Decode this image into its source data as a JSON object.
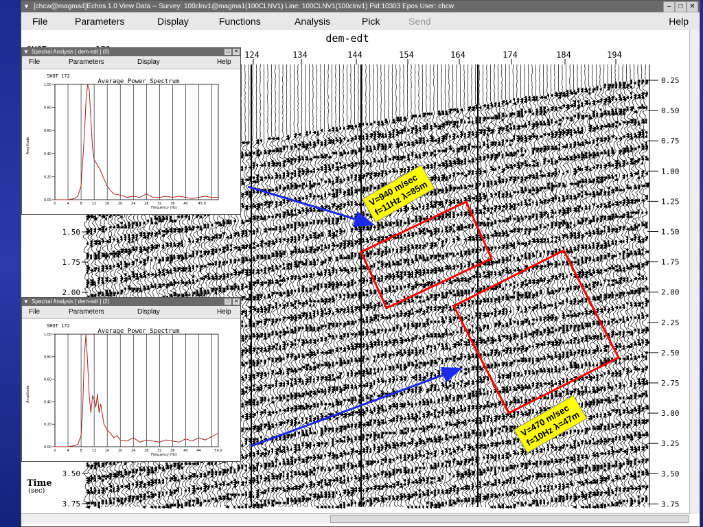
{
  "window": {
    "title": "[chcw@magma4]Echos 1.0 View Data   -- Survey: 100clnv1@magma1(100CLNV1)   Line: 100CLNV1(100clnv1)   Pid:10303   Epos User: chcw",
    "menu": [
      "File",
      "Parameters",
      "Display",
      "Functions",
      "Analysis",
      "Pick",
      "Send",
      "Help"
    ],
    "disabled_menu": "Send"
  },
  "plot": {
    "title": "dem-edt",
    "shot_label": "SHOT",
    "shot_value": "172",
    "trace_ticks": [
      "124",
      "134",
      "144",
      "154",
      "164",
      "174",
      "184",
      "194"
    ],
    "time_ticks_right": [
      "0.25",
      "0.50",
      "0.75",
      "1.00",
      "1.25",
      "1.50",
      "1.75",
      "2.00",
      "2.25",
      "2.50",
      "2.75",
      "3.00",
      "3.25",
      "3.50",
      "3.75"
    ],
    "time_ticks_left": [
      "1.50",
      "1.75",
      "2.00",
      "3.50",
      "3.75"
    ],
    "time_axis_label": "Time",
    "time_axis_unit": "(sec)"
  },
  "spectral_windows": [
    {
      "title": "Spectral Analysis [ dem-edt ] (0)",
      "menu": [
        "File",
        "Parameters",
        "Display",
        "Help"
      ],
      "header": "SHOT 172",
      "chart_title": "Average Power Spectrum",
      "xlabel": "Frequency (Hz)",
      "ylabel": "Amplitude"
    },
    {
      "title": "Spectral Analysis [ dem-edt ] (2)",
      "menu": [
        "File",
        "Parameters",
        "Display",
        "Help"
      ],
      "header": "SHOT 172",
      "chart_title": "Average Power Spectrum",
      "xlabel": "Frequency (Hz)",
      "ylabel": "Amplitude"
    }
  ],
  "chart_data": [
    {
      "type": "line",
      "title": "Average Power Spectrum",
      "xlabel": "Frequency (Hz)",
      "ylabel": "Amplitude",
      "xlim": [
        0,
        50
      ],
      "ylim": [
        0,
        1
      ],
      "x_ticks": [
        "0",
        "4",
        "8",
        "12",
        "16",
        "20",
        "24",
        "28",
        "32",
        "36",
        "40",
        "44",
        "48"
      ],
      "x_ticks_labeled": [
        "0",
        "4",
        "8",
        "12",
        "16",
        "20",
        "24",
        "28",
        "32",
        "36",
        "40",
        "45.0"
      ],
      "y_ticks": [
        "0.00",
        "0.20",
        "0.40",
        "0.60",
        "0.80",
        "1.00"
      ],
      "grid": true,
      "x": [
        0,
        4,
        6,
        7,
        8,
        9,
        9.5,
        10,
        10.5,
        11,
        11.5,
        12,
        13,
        14,
        15,
        16,
        17,
        18,
        20,
        22,
        24,
        26,
        28,
        30,
        32,
        34,
        36,
        38,
        40,
        42,
        44,
        46,
        48,
        50
      ],
      "y": [
        0,
        0,
        0.01,
        0.03,
        0.12,
        0.55,
        0.85,
        1.0,
        0.95,
        0.7,
        0.45,
        0.35,
        0.3,
        0.25,
        0.18,
        0.12,
        0.08,
        0.05,
        0.04,
        0.02,
        0.03,
        0.02,
        0.05,
        0.02,
        0.02,
        0.03,
        0.02,
        0.03,
        0.02,
        0.01,
        0.02,
        0.03,
        0.02,
        0.02
      ],
      "color": "#b02020"
    },
    {
      "type": "line",
      "title": "Average Power Spectrum",
      "xlabel": "Frequency (Hz)",
      "ylabel": "Amplitude",
      "xlim": [
        0,
        50
      ],
      "ylim": [
        0,
        1
      ],
      "x_ticks": [
        "0",
        "4",
        "8",
        "12",
        "16",
        "20",
        "24",
        "28",
        "32",
        "36",
        "40",
        "44",
        "48"
      ],
      "x_ticks_labeled": [
        "0",
        "4",
        "8",
        "12",
        "16",
        "20",
        "24",
        "28",
        "32",
        "36",
        "40",
        "44",
        "50.0"
      ],
      "y_ticks": [
        "0.00",
        "0.20",
        "0.40",
        "0.60",
        "0.80",
        "1.00"
      ],
      "grid": true,
      "x": [
        0,
        4,
        6,
        7,
        8,
        8.5,
        9,
        9.5,
        10,
        10.5,
        11,
        11.5,
        12,
        12.5,
        13,
        13.5,
        14,
        15,
        16,
        17,
        18,
        19,
        20,
        22,
        24,
        26,
        28,
        30,
        32,
        34,
        36,
        38,
        40,
        42,
        44,
        46,
        48,
        50
      ],
      "y": [
        0,
        0,
        0.01,
        0.02,
        0.1,
        0.35,
        0.8,
        1.0,
        0.75,
        0.45,
        0.3,
        0.45,
        0.42,
        0.35,
        0.47,
        0.3,
        0.38,
        0.2,
        0.15,
        0.12,
        0.08,
        0.1,
        0.06,
        0.05,
        0.08,
        0.04,
        0.06,
        0.05,
        0.04,
        0.06,
        0.05,
        0.04,
        0.07,
        0.05,
        0.08,
        0.06,
        0.09,
        0.12
      ],
      "color": "#b02020"
    }
  ],
  "annotations": [
    {
      "line1": "V=940 m/sec",
      "line2": "f=11Hz  λ=85m"
    },
    {
      "line1": "V=470 m/sec",
      "line2": "f=10Hz  λ=47m"
    }
  ],
  "colors": {
    "background": "#1a2a8c",
    "titlebar": "#6a6a6a",
    "menubar": "#e8e8e8",
    "callout": "#ffff00",
    "box": "#ff0000",
    "arrow": "#1a2ae8"
  }
}
